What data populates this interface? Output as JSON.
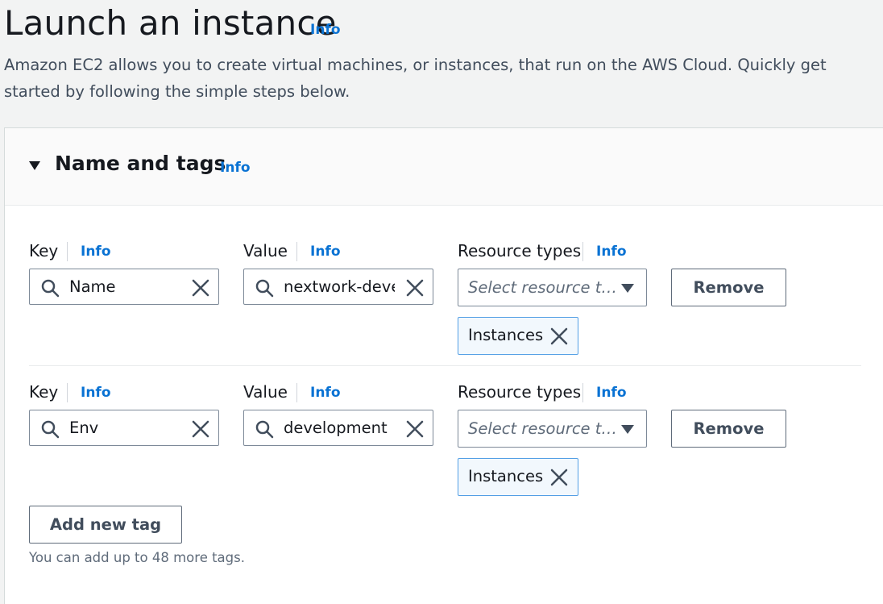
{
  "page": {
    "title": "Launch an instance",
    "title_info": "Info",
    "description": "Amazon EC2 allows you to create virtual machines, or instances, that run on the AWS Cloud. Quickly get started by following the simple steps below."
  },
  "section": {
    "title": "Name and tags",
    "info": "Info",
    "expanded": true
  },
  "tags": [
    {
      "key_label": "Key",
      "key_info": "Info",
      "key_value": "Name",
      "value_label": "Value",
      "value_info": "Info",
      "value_value": "nextwork-deve",
      "resource_label": "Resource types",
      "resource_info": "Info",
      "resource_placeholder": "Select resource t…",
      "selected_resource": "Instances",
      "remove_label": "Remove"
    },
    {
      "key_label": "Key",
      "key_info": "Info",
      "key_value": "Env",
      "value_label": "Value",
      "value_info": "Info",
      "value_value": "development",
      "resource_label": "Resource types",
      "resource_info": "Info",
      "resource_placeholder": "Select resource t…",
      "selected_resource": "Instances",
      "remove_label": "Remove"
    }
  ],
  "add_tag_label": "Add new tag",
  "tag_limit_hint": "You can add up to 48 more tags.",
  "icons": {
    "search": "search-icon",
    "clear": "close-icon",
    "dropdown": "caret-down-icon",
    "expand": "caret-down-icon"
  },
  "colors": {
    "link": "#0972d3",
    "token_border": "#539fe5",
    "token_bg": "#f2f8fd",
    "page_bg": "#f2f3f3"
  }
}
